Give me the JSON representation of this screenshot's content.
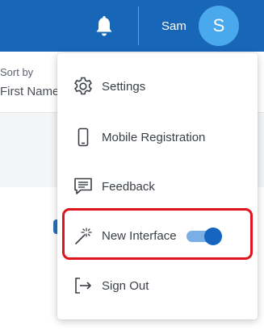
{
  "header": {
    "user_name": "Sam",
    "avatar_initial": "S",
    "bell_icon": "bell-icon",
    "brand_color": "#1866b8",
    "avatar_color": "#4aa9ec"
  },
  "background": {
    "sort_by_label": "Sort by",
    "sort_by_value": "First Name"
  },
  "menu": {
    "items": [
      {
        "label": "Settings",
        "icon": "gear-icon"
      },
      {
        "label": "Mobile Registration",
        "icon": "mobile-phone-icon"
      },
      {
        "label": "Feedback",
        "icon": "feedback-icon"
      },
      {
        "label": "New Interface",
        "icon": "magic-wand-icon",
        "toggle_on": true
      },
      {
        "label": "Sign Out",
        "icon": "sign-out-icon"
      }
    ],
    "highlight_color": "#e0141e",
    "toggle_color": "#1565c0"
  }
}
